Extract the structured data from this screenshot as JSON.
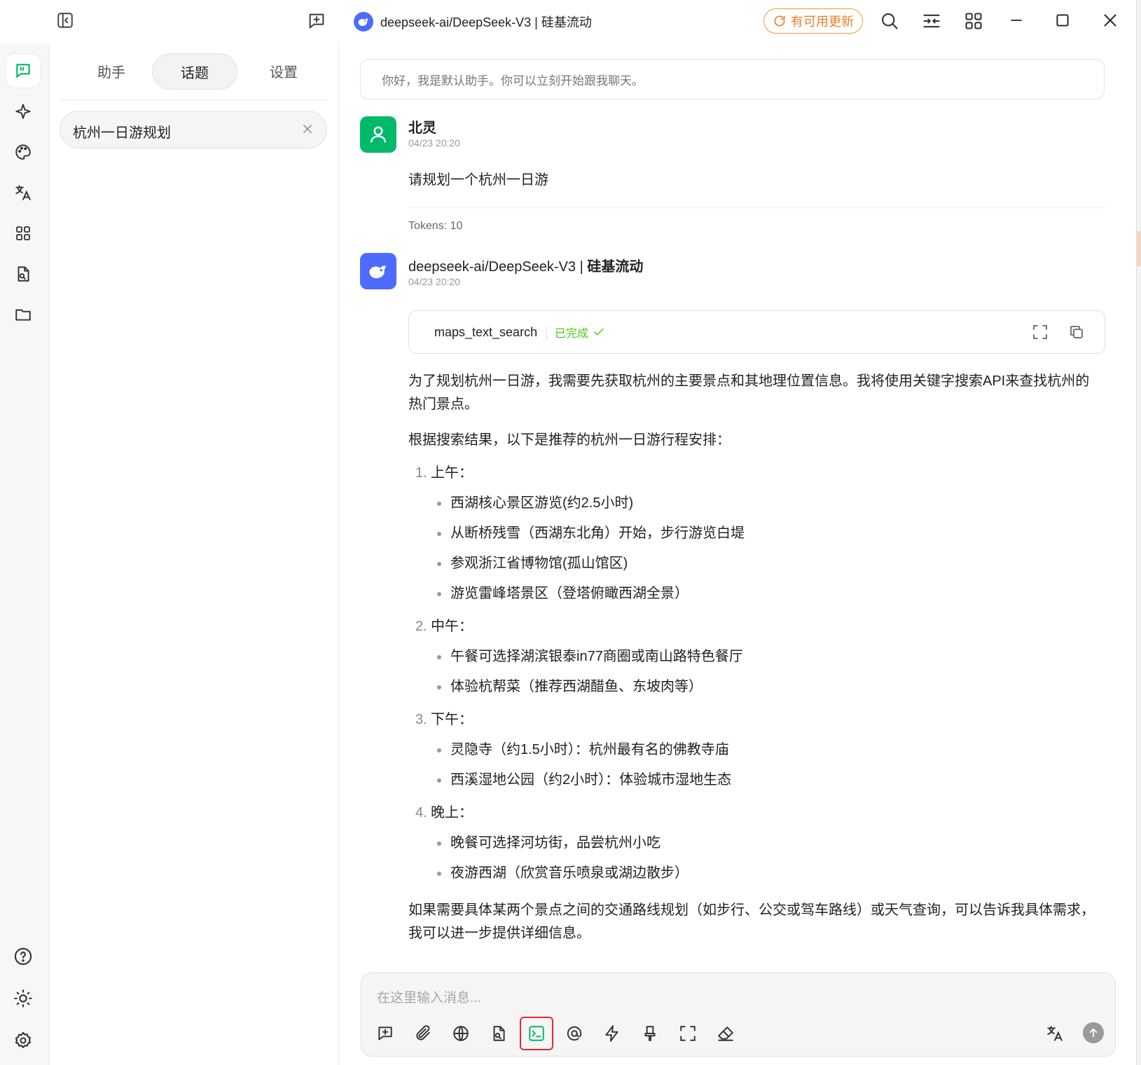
{
  "window": {
    "title": "deepseek-ai/DeepSeek-V3 | 硅基流动",
    "update_label": "有可用更新"
  },
  "sidebar": {
    "icons": [
      "chat-icon",
      "sparkle-icon",
      "palette-icon",
      "translate-icon",
      "apps-icon",
      "file-search-icon",
      "folder-icon"
    ],
    "bottom_icons": [
      "help-icon",
      "theme-icon",
      "settings-icon"
    ]
  },
  "panel": {
    "tabs": [
      {
        "label": "助手"
      },
      {
        "label": "话题"
      },
      {
        "label": "设置"
      }
    ],
    "active_tab": "话题",
    "topics": [
      {
        "label": "杭州一日游规划"
      }
    ]
  },
  "chat": {
    "welcome": "你好，我是默认助手。你可以立刻开始跟我聊天。",
    "user_message": {
      "name": "北灵",
      "time": "04/23 20:20",
      "text": "请规划一个杭州一日游",
      "tokens": "Tokens: 10"
    },
    "assistant_message": {
      "name_model": "deepseek-ai/DeepSeek-V3 | ",
      "name_provider": "硅基流动",
      "time": "04/23 20:20",
      "tool": {
        "name": "maps_text_search",
        "status": "已完成"
      },
      "intro": "为了规划杭州一日游，我需要先获取杭州的主要景点和其地理位置信息。我将使用关键字搜索API来查找杭州的热门景点。",
      "lead": "根据搜索结果，以下是推荐的杭州一日游行程安排：",
      "sections": [
        {
          "num": "1.",
          "title": "上午：",
          "items": [
            "西湖核心景区游览(约2.5小时)",
            "从断桥残雪（西湖东北角）开始，步行游览白堤",
            "参观浙江省博物馆(孤山馆区)",
            "游览雷峰塔景区（登塔俯瞰西湖全景）"
          ]
        },
        {
          "num": "2.",
          "title": "中午：",
          "items": [
            "午餐可选择湖滨银泰in77商圈或南山路特色餐厅",
            "体验杭帮菜（推荐西湖醋鱼、东坡肉等）"
          ]
        },
        {
          "num": "3.",
          "title": "下午：",
          "items": [
            "灵隐寺（约1.5小时）：杭州最有名的佛教寺庙",
            "西溪湿地公园（约2小时）：体验城市湿地生态"
          ]
        },
        {
          "num": "4.",
          "title": "晚上：",
          "items": [
            "晚餐可选择河坊街，品尝杭州小吃",
            "夜游西湖（欣赏音乐喷泉或湖边散步）"
          ]
        }
      ],
      "closing": "如果需要具体某两个景点之间的交通路线规划（如步行、公交或驾车路线）或天气查询，可以告诉我具体需求，我可以进一步提供详细信息。"
    },
    "watermark": "北灵"
  },
  "composer": {
    "placeholder": "在这里输入消息...",
    "toolbar_icons": [
      "new-topic-icon",
      "attachment-icon",
      "web-search-icon",
      "knowledge-icon",
      "mcp-terminal-icon",
      "mention-icon",
      "quick-phrase-icon",
      "clear-icon",
      "expand-icon",
      "eraser-icon"
    ],
    "highlighted_tool": "mcp-terminal-icon"
  },
  "colors": {
    "brand_green": "#00b96b",
    "deepseek_blue": "#4d6bfe",
    "update_orange": "#f29b38",
    "success_green": "#52c41a",
    "highlight_red": "#e12b2b"
  }
}
